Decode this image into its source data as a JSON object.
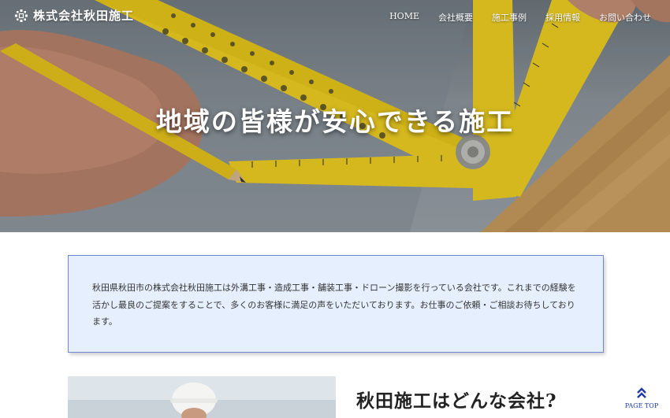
{
  "site": {
    "logo_text": "株式会社秋田施工"
  },
  "nav": {
    "items": [
      {
        "label": "HOME"
      },
      {
        "label": "会社概要"
      },
      {
        "label": "施工事例"
      },
      {
        "label": "採用情報"
      },
      {
        "label": "お問い合わせ"
      }
    ]
  },
  "hero": {
    "title": "地域の皆様が安心できる施工"
  },
  "intro": {
    "text": "秋田県秋田市の株式会社秋田施工は外溝工事・造成工事・舗装工事・ドローン撮影を行っている会社です。これまでの経験を活かし最良のご提案をすることで、多くのお客様に満足の声をいただいております。お仕事のご依頼・ご相談お待ちしております。"
  },
  "about": {
    "heading": "秋田施工はどんな会社?"
  },
  "page_top": {
    "label": "PAGE TOP"
  },
  "colors": {
    "accent": "#1f3aa6",
    "intro_bg": "#e6effd",
    "intro_border": "#6f86d6",
    "ruler_yellow": "#f1cf1f"
  }
}
